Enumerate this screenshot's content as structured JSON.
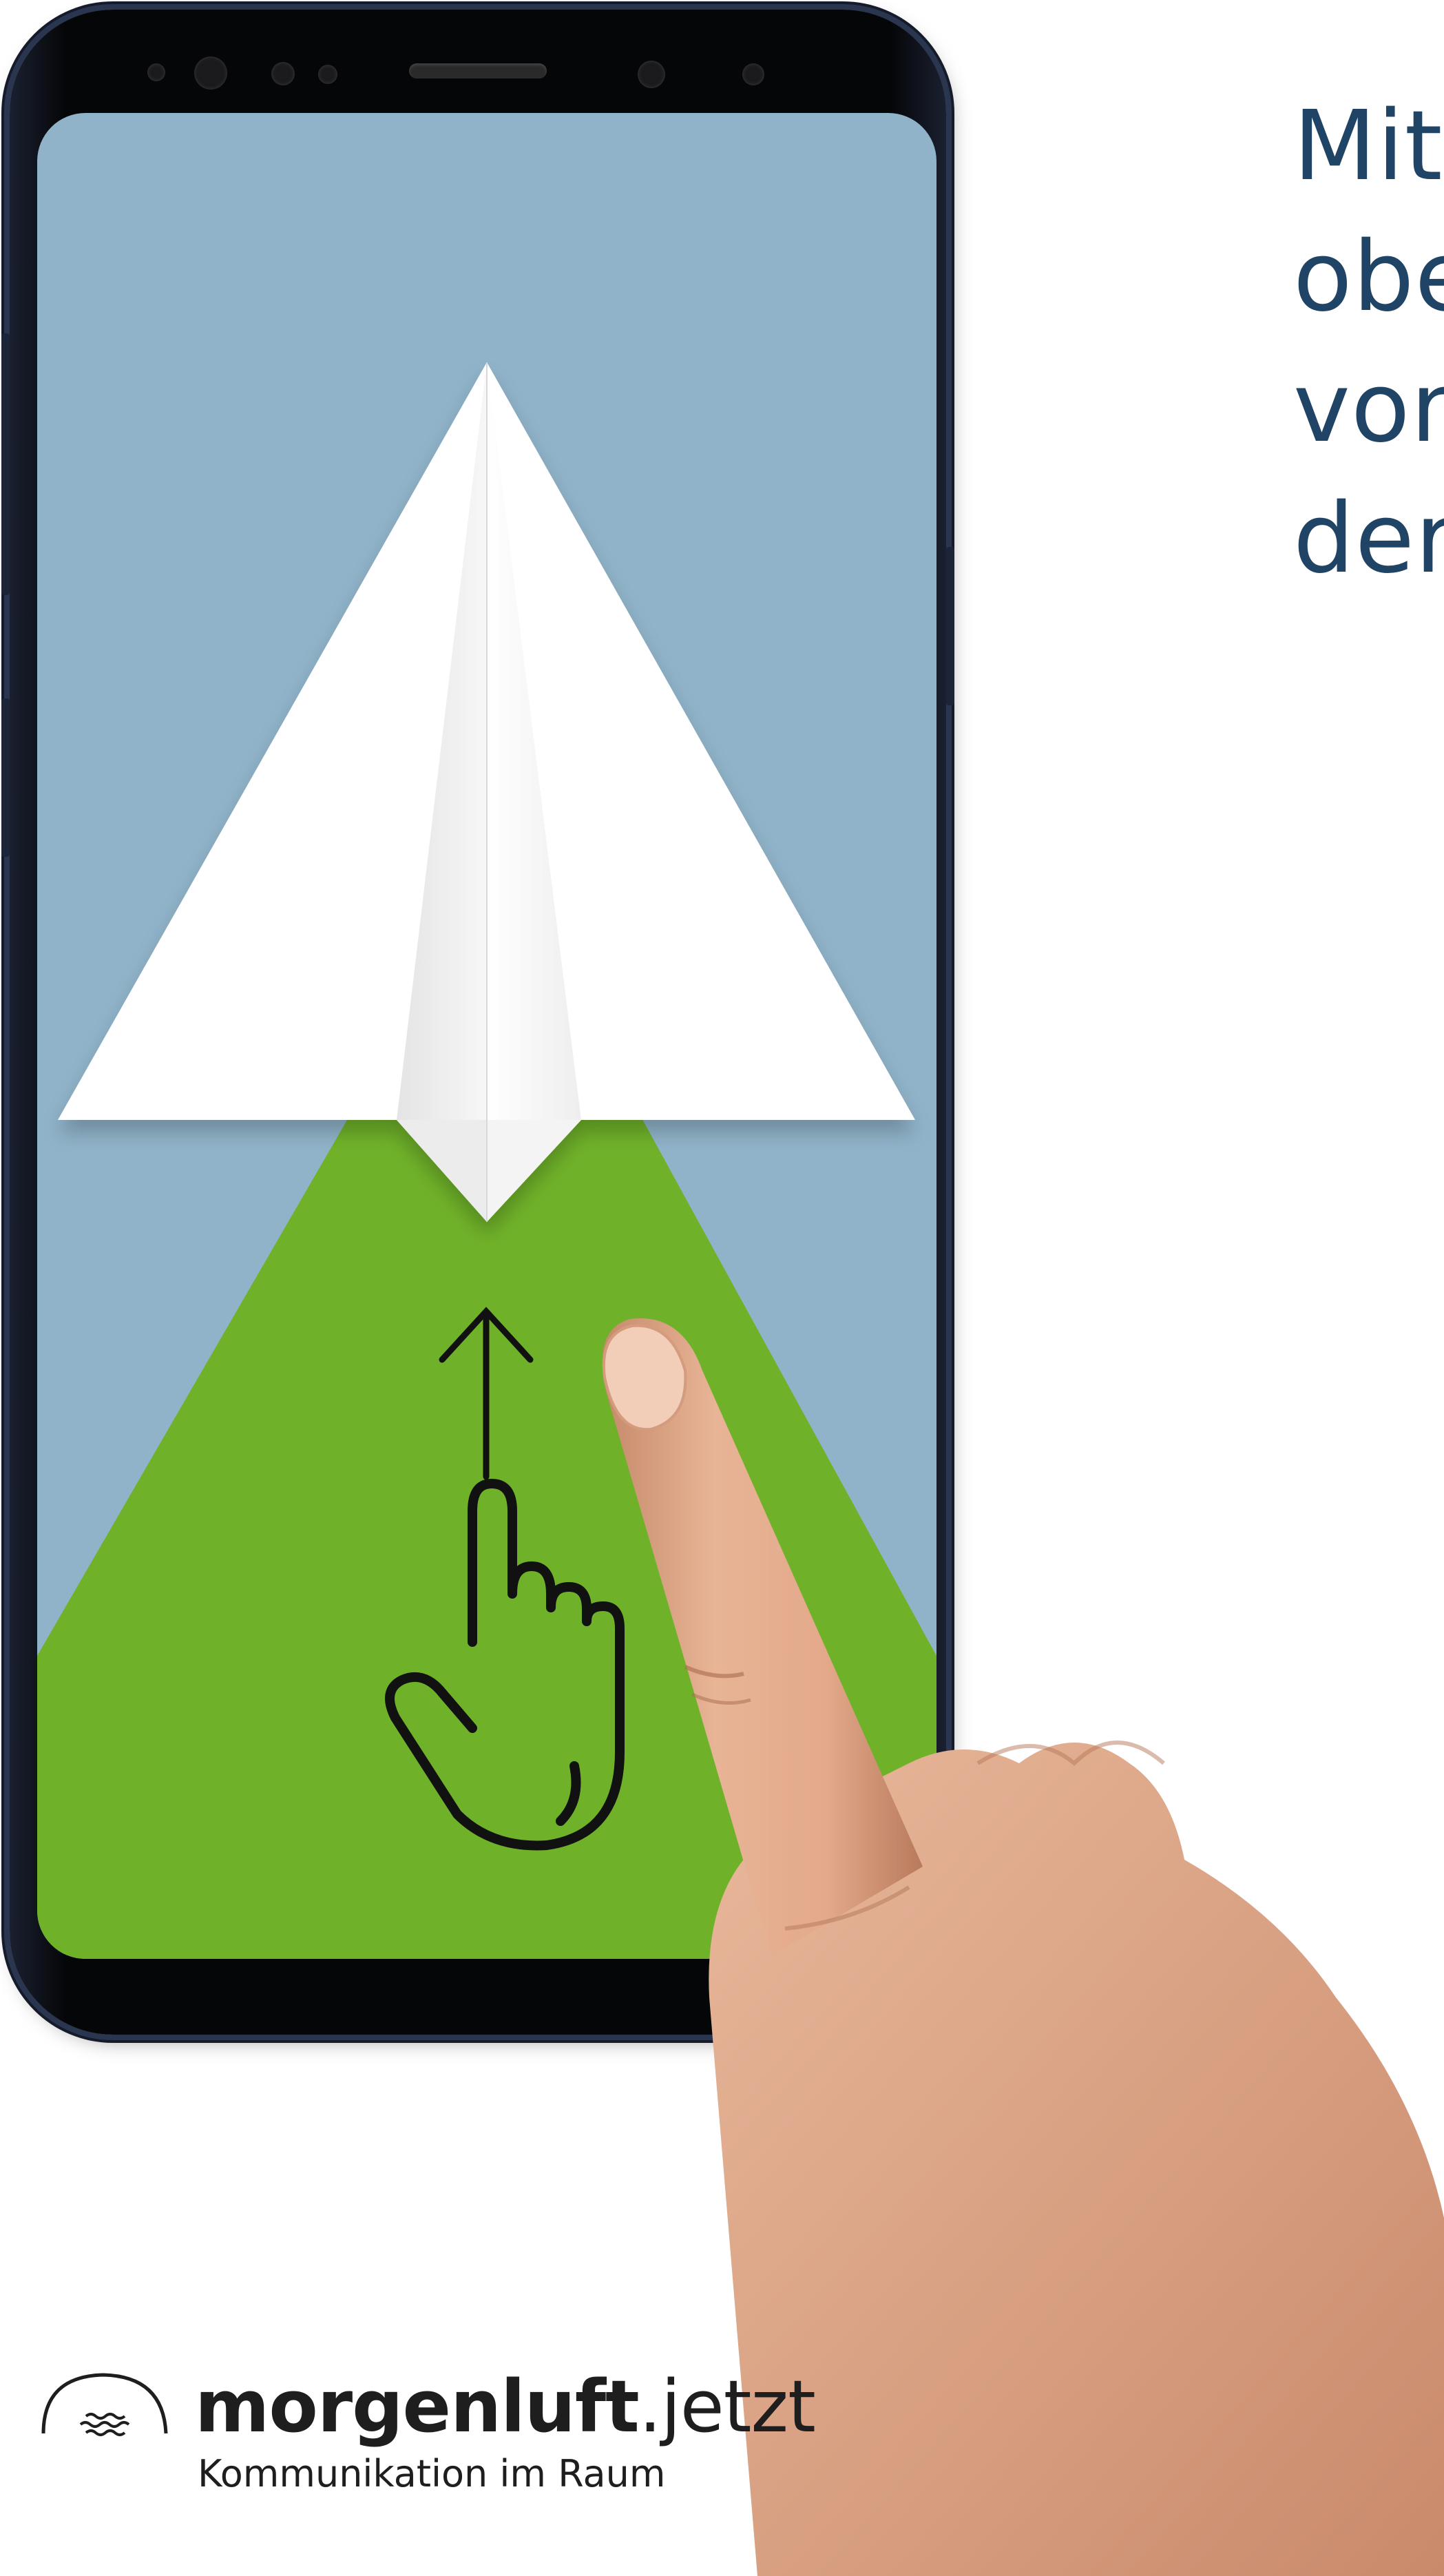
{
  "headline": {
    "lines": [
      "Mit",
      "obe",
      "von",
      "der"
    ]
  },
  "logo": {
    "name_bold": "morgenluft",
    "name_light": ".jetzt",
    "tagline": "Kommunikation im Raum"
  },
  "screen": {
    "background_color": "#90b3c9",
    "path_color": "#6fb229",
    "plane_color": "#ffffff",
    "gesture": "swipe-up"
  },
  "icons": [
    "paper-plane-icon",
    "arrow-up-icon",
    "pointing-hand-icon",
    "logo-mark-icon"
  ]
}
